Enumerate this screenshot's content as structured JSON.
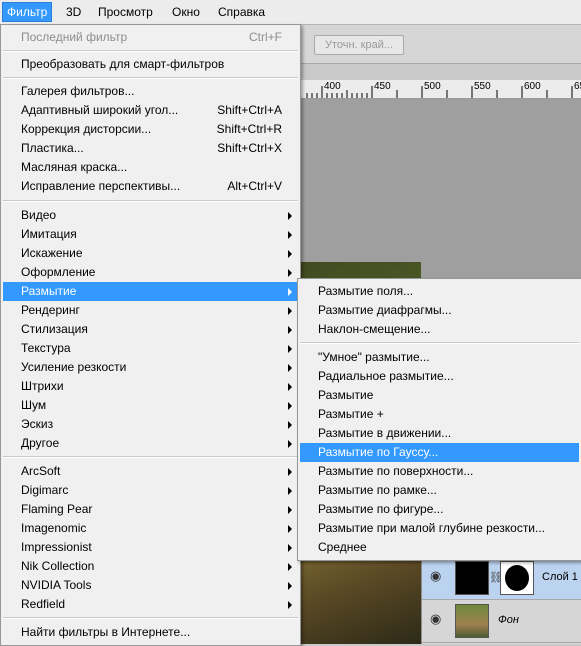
{
  "menubar": {
    "items": [
      "Фильтр",
      "3D",
      "Просмотр",
      "Окно",
      "Справка"
    ]
  },
  "options_bar": {
    "refine_edge": "Уточн. край..."
  },
  "ruler": {
    "labels": [
      "400",
      "450",
      "500",
      "550",
      "600",
      "65"
    ]
  },
  "layers": [
    {
      "name": "Слой 1",
      "selected": true
    },
    {
      "name": "Фон",
      "selected": false
    }
  ],
  "filter_menu": {
    "last_filter": {
      "label": "Последний фильтр",
      "shortcut": "Ctrl+F"
    },
    "convert_smart": "Преобразовать для смарт-фильтров",
    "gallery": "Галерея фильтров...",
    "adaptive_wide": {
      "label": "Адаптивный широкий угол...",
      "shortcut": "Shift+Ctrl+A"
    },
    "lens_correction": {
      "label": "Коррекция дисторсии...",
      "shortcut": "Shift+Ctrl+R"
    },
    "liquify": {
      "label": "Пластика...",
      "shortcut": "Shift+Ctrl+X"
    },
    "oil_paint": "Масляная краска...",
    "vanishing_point": {
      "label": "Исправление перспективы...",
      "shortcut": "Alt+Ctrl+V"
    },
    "groups": [
      "Видео",
      "Имитация",
      "Искажение",
      "Оформление",
      "Размытие",
      "Рендеринг",
      "Стилизация",
      "Текстура",
      "Усиление резкости",
      "Штрихи",
      "Шум",
      "Эскиз",
      "Другое"
    ],
    "plugins": [
      "ArcSoft",
      "Digimarc",
      "Flaming Pear",
      "Imagenomic",
      "Impressionist",
      "Nik Collection",
      "NVIDIA Tools",
      "Redfield"
    ],
    "browse_online": "Найти фильтры в Интернете..."
  },
  "blur_submenu": {
    "gallery_items": [
      "Размытие поля...",
      "Размытие диафрагмы...",
      "Наклон-смещение..."
    ],
    "items": [
      "\"Умное\" размытие...",
      "Радиальное размытие...",
      "Размытие",
      "Размытие +",
      "Размытие в движении...",
      "Размытие по Гауссу...",
      "Размытие по поверхности...",
      "Размытие по рамке...",
      "Размытие по фигуре...",
      "Размытие при малой глубине резкости...",
      "Среднее"
    ]
  },
  "highlight_color": "#3399ff"
}
